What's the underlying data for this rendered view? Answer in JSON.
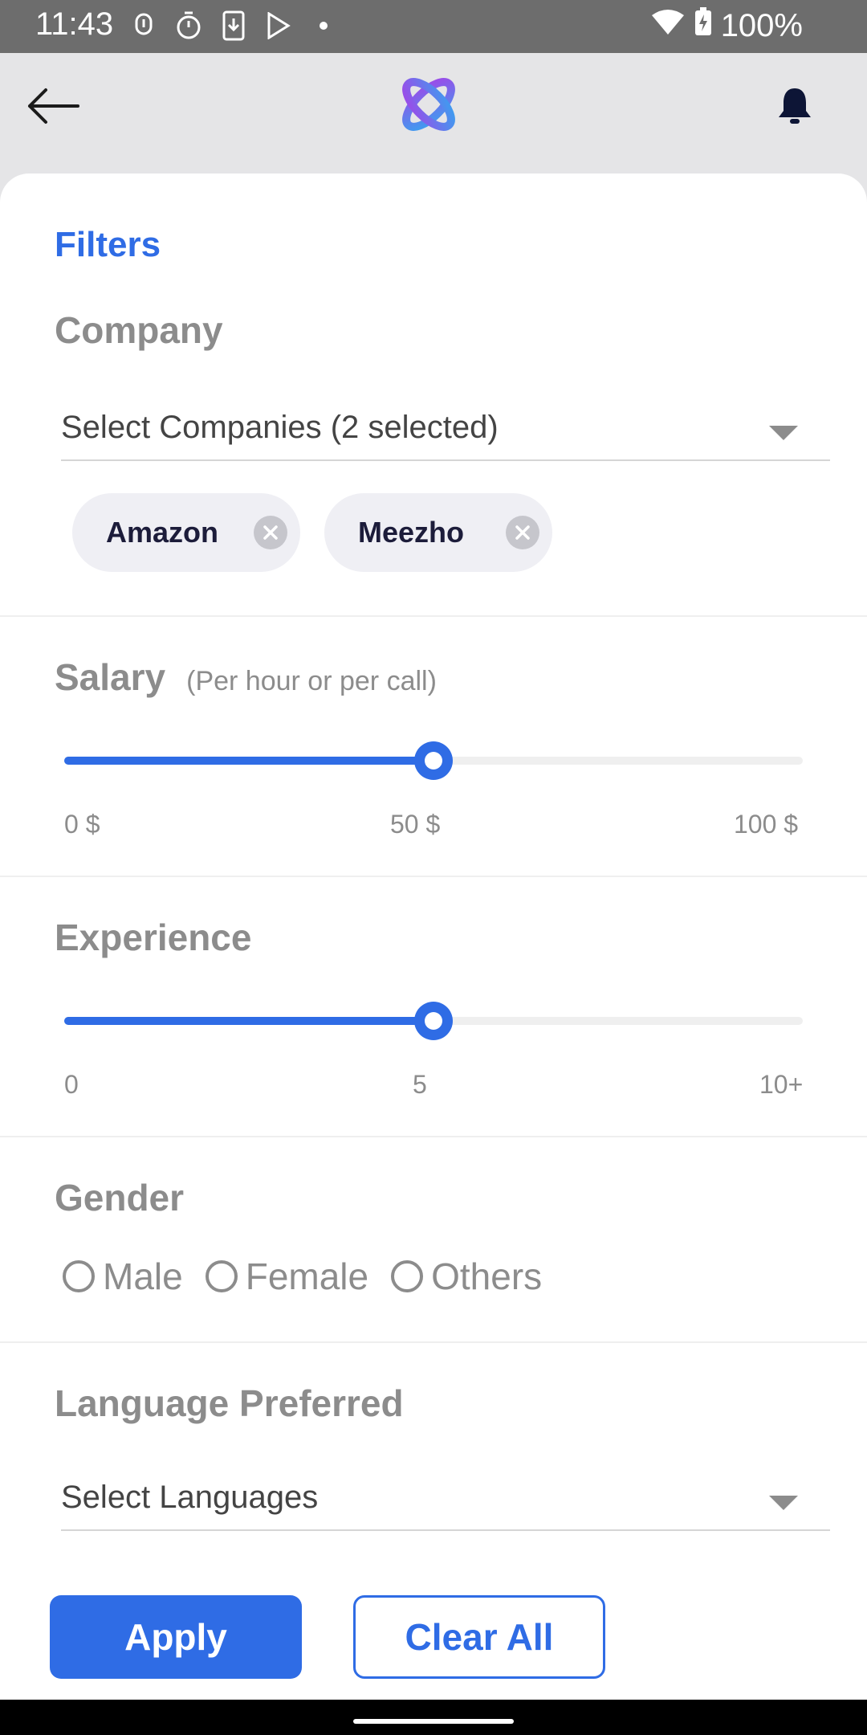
{
  "status_bar": {
    "time": "11:43",
    "battery": "100%"
  },
  "header": {
    "back_icon": "arrow-left-icon",
    "logo": "app-logo",
    "bell_icon": "bell-icon"
  },
  "filters": {
    "title": "Filters"
  },
  "company": {
    "label": "Company",
    "dropdown_text": "Select Companies (2 selected)",
    "chips": [
      "Amazon",
      "Meezho"
    ]
  },
  "salary": {
    "label": "Salary",
    "sublabel": "(Per hour or per call)",
    "min_label": "0 $",
    "mid_label": "50 $",
    "max_label": "100 $",
    "value": 50,
    "min": 0,
    "max": 100
  },
  "experience": {
    "label": "Experience",
    "min_label": "0",
    "mid_label": "5",
    "max_label": "10+",
    "value": 5,
    "min": 0,
    "max": 10
  },
  "gender": {
    "label": "Gender",
    "options": [
      "Male",
      "Female",
      "Others"
    ]
  },
  "language": {
    "label": "Language Preferred",
    "dropdown_text": "Select Languages"
  },
  "actions": {
    "apply": "Apply",
    "clear": "Clear All"
  },
  "colors": {
    "accent": "#2f6ce5",
    "muted_text": "#8c8c8c"
  }
}
